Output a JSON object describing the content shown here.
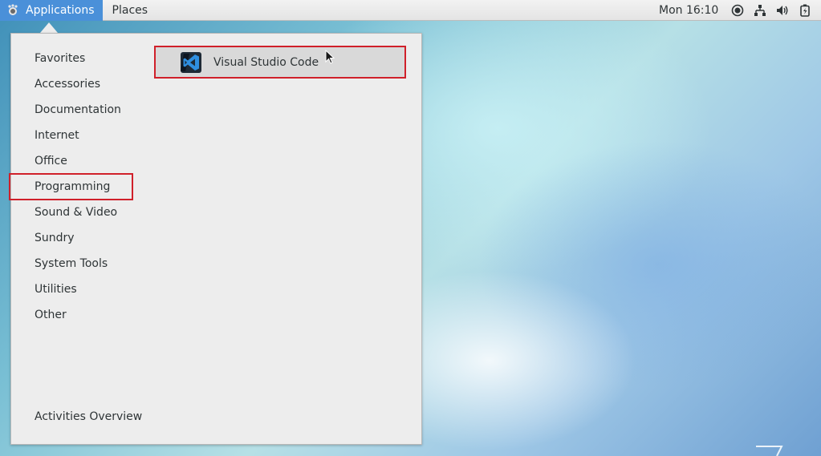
{
  "topbar": {
    "applications_label": "Applications",
    "places_label": "Places",
    "clock": "Mon 16:10",
    "tray_icons": [
      "accessibility-icon",
      "network-icon",
      "volume-icon",
      "battery-icon"
    ]
  },
  "menu": {
    "categories": [
      {
        "label": "Favorites"
      },
      {
        "label": "Accessories"
      },
      {
        "label": "Documentation"
      },
      {
        "label": "Internet"
      },
      {
        "label": "Office"
      },
      {
        "label": "Programming"
      },
      {
        "label": "Sound & Video"
      },
      {
        "label": "Sundry"
      },
      {
        "label": "System Tools"
      },
      {
        "label": "Utilities"
      },
      {
        "label": "Other"
      }
    ],
    "selected_category": "Programming",
    "activities_label": "Activities Overview",
    "apps": [
      {
        "label": "Visual Studio Code",
        "icon": "vscode-icon"
      }
    ]
  },
  "colors": {
    "accent": "#4a90d9",
    "highlight_border": "#d0202a",
    "panel_bg": "#ededed"
  }
}
